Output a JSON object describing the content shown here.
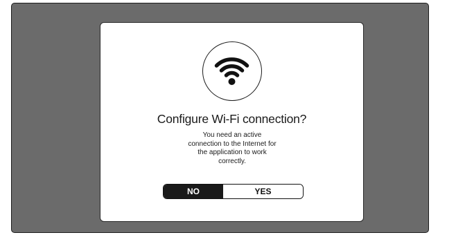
{
  "dialog": {
    "icon": "wifi-icon",
    "title": "Configure Wi-Fi connection?",
    "message_lines": [
      "You need an active",
      "connection to the Internet for",
      "the application to work",
      "correctly."
    ],
    "no_label": "NO",
    "yes_label": "YES",
    "selected_option": "NO"
  },
  "colors": {
    "backdrop": "#6b6b6b",
    "dialog_bg": "#ffffff",
    "selected_bg": "#1a1a1a",
    "text": "#1a1a1a"
  }
}
